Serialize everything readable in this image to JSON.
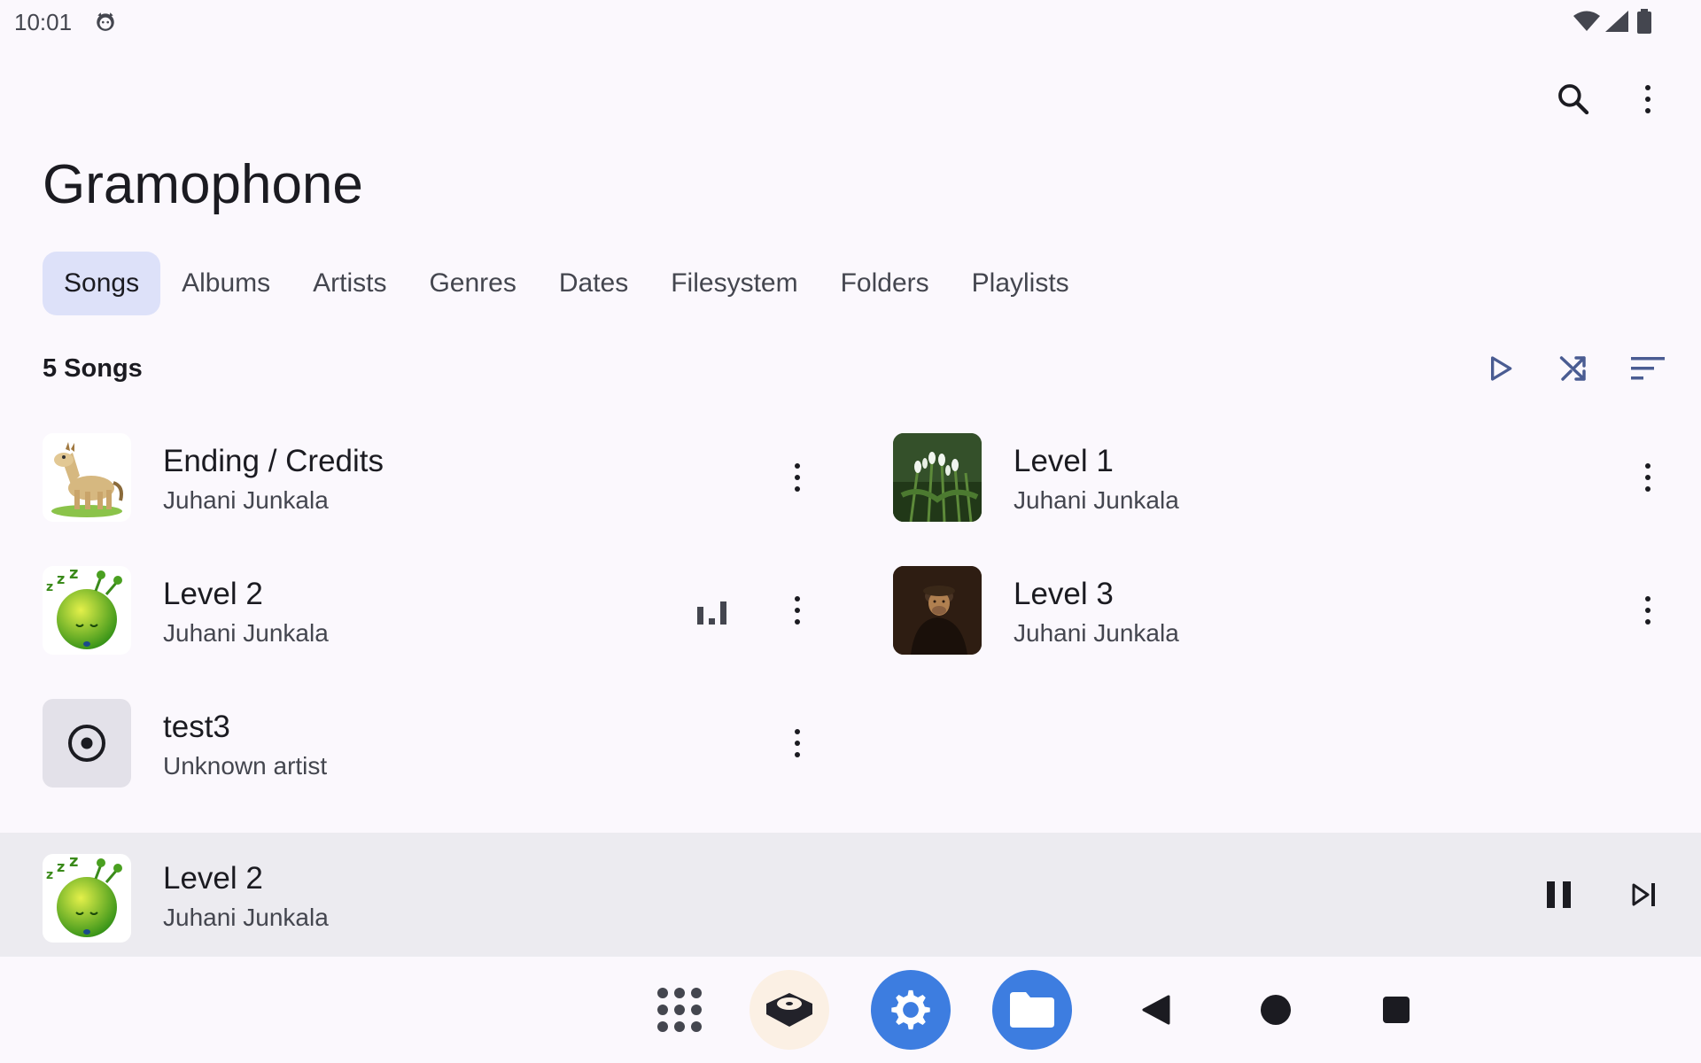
{
  "status": {
    "time": "10:01"
  },
  "app": {
    "title": "Gramophone"
  },
  "tabs": [
    {
      "label": "Songs",
      "active": true
    },
    {
      "label": "Albums",
      "active": false
    },
    {
      "label": "Artists",
      "active": false
    },
    {
      "label": "Genres",
      "active": false
    },
    {
      "label": "Dates",
      "active": false
    },
    {
      "label": "Filesystem",
      "active": false
    },
    {
      "label": "Folders",
      "active": false
    },
    {
      "label": "Playlists",
      "active": false
    }
  ],
  "list": {
    "count_label": "5 Songs",
    "songs": [
      {
        "title": "Ending / Credits",
        "artist": "Juhani Junkala",
        "art": "horse",
        "playing": false
      },
      {
        "title": "Level 1",
        "artist": "Juhani Junkala",
        "art": "snowdrops",
        "playing": false
      },
      {
        "title": "Level 2",
        "artist": "Juhani Junkala",
        "art": "sleepy-alien",
        "playing": true
      },
      {
        "title": "Level 3",
        "artist": "Juhani Junkala",
        "art": "portrait",
        "playing": false
      },
      {
        "title": "test3",
        "artist": "Unknown artist",
        "art": "disc-placeholder",
        "playing": false
      }
    ]
  },
  "now_playing": {
    "title": "Level 2",
    "artist": "Juhani Junkala",
    "state": "playing"
  },
  "colors": {
    "accent": "#4a5c92",
    "tab_active_bg": "#dde1f9",
    "background": "#fbf8fd",
    "player_bg": "#ecebf0"
  }
}
